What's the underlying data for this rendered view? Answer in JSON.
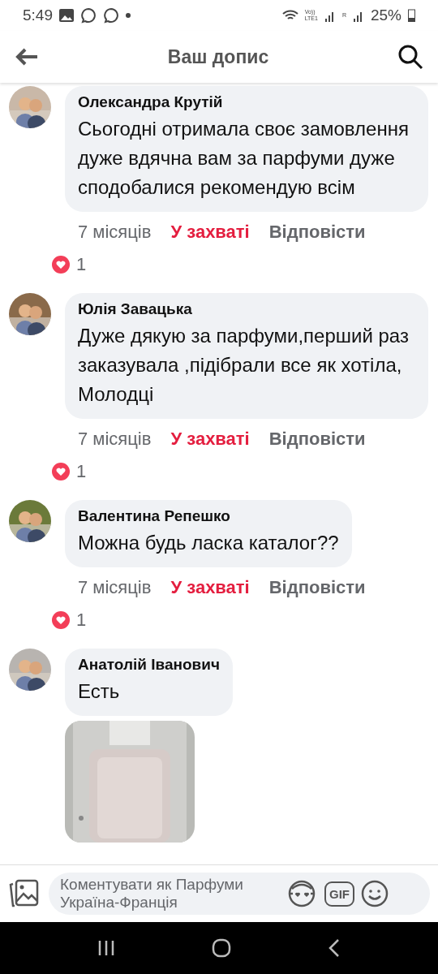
{
  "status_bar": {
    "time": "5:49",
    "network_top": "Vo))",
    "network_bottom": "LTE1",
    "roaming": "R",
    "battery": "25%"
  },
  "header": {
    "title": "Ваш допис"
  },
  "comments": [
    {
      "author": "Олександра Крутій",
      "text": "Сьогодні отримала своє замовлення дуже вдячна вам за парфуми дуже сподобалися рекомендую всім",
      "time": "7 місяців",
      "reaction_label": "У захваті",
      "reacted": true,
      "reply": "Відповісти",
      "reaction_count": "1"
    },
    {
      "author": "Юлія Завацька",
      "text": "Дуже дякую за парфуми,перший раз заказувала ,підібрали все як хотіла, Молодці",
      "time": "7 місяців",
      "reaction_label": "У захваті",
      "reacted": true,
      "reply": "Відповісти",
      "reaction_count": "1"
    },
    {
      "author": "Валентина Репешко",
      "text": "Можна будь ласка каталог??",
      "time": "7 місяців",
      "reaction_label": "У захваті",
      "reacted": true,
      "reply": "Відповісти",
      "reaction_count": "1"
    },
    {
      "author": "Анатолій Іванович",
      "text": "Есть"
    }
  ],
  "composer": {
    "placeholder": "Коментувати як Парфуми Україна-Франція",
    "gif_label": "GIF"
  }
}
